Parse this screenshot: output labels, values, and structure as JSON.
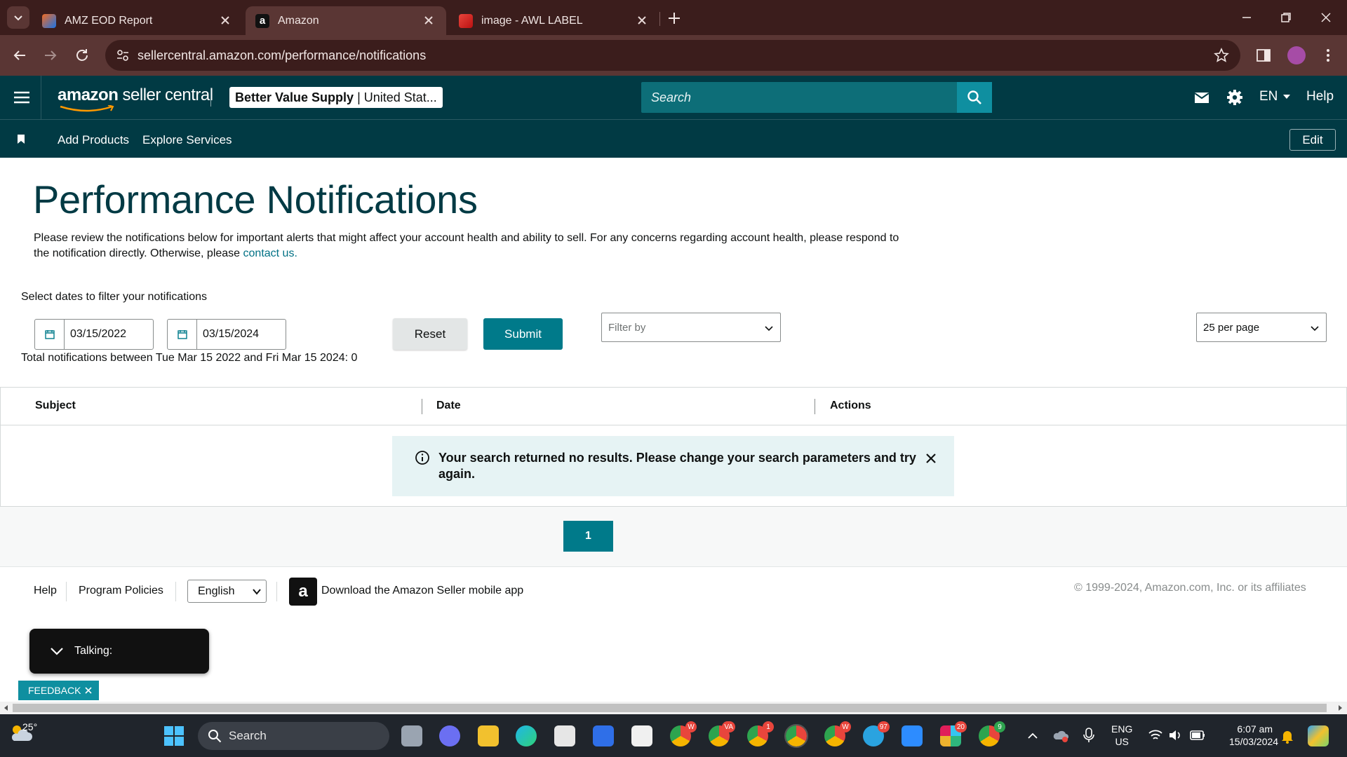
{
  "browser": {
    "tabs": [
      {
        "title": "AMZ EOD Report",
        "active": false
      },
      {
        "title": "Amazon",
        "active": true
      },
      {
        "title": "image - AWL LABEL",
        "active": false
      }
    ],
    "url": "sellercentral.amazon.com/performance/notifications"
  },
  "header": {
    "logo_bold": "amazon",
    "logo_rest": " seller central",
    "account_name": "Better Value Supply",
    "account_market": "| United Stat...",
    "search_placeholder": "Search",
    "lang": "EN",
    "help": "Help"
  },
  "subnav": {
    "items": [
      "Add Products",
      "Explore Services"
    ],
    "edit": "Edit"
  },
  "page": {
    "title": "Performance Notifications",
    "intro": "Please review the notifications below for important alerts that might affect your account health and ability to sell. For any concerns regarding account health, please respond to the notification directly. Otherwise, please ",
    "contact_link": "contact us.",
    "date_label": "Select dates to filter your notifications",
    "date_from": "03/15/2022",
    "date_to": "03/15/2024",
    "reset": "Reset",
    "submit": "Submit",
    "filter_placeholder": "Filter by",
    "per_page": "25 per page",
    "total": "Total notifications between Tue Mar 15 2022 and Fri Mar 15 2024: 0"
  },
  "table": {
    "columns": [
      "Subject",
      "Date",
      "Actions"
    ],
    "empty_message": "Your search returned no results. Please change your search parameters and try again."
  },
  "pagination": {
    "current": "1"
  },
  "footer": {
    "help": "Help",
    "program_policies": "Program Policies",
    "language": "English",
    "app_text": "Download the Amazon Seller mobile app",
    "copyright": "© 1999-2024, Amazon.com, Inc. or its affiliates"
  },
  "overlay": {
    "talking": "Talking:",
    "feedback": "FEEDBACK"
  },
  "taskbar": {
    "weather": "25°",
    "search": "Search",
    "badges": [
      "W",
      "VA",
      "1",
      "",
      "W",
      "97",
      "20",
      "9"
    ],
    "lang_top": "ENG",
    "lang_bottom": "US",
    "time": "6:07 am",
    "date": "15/03/2024"
  },
  "colors": {
    "header_bg": "#013a44",
    "accent": "#007a8a",
    "tab_bg": "#3b1d1c",
    "alert_bg": "#e6f3f4"
  }
}
